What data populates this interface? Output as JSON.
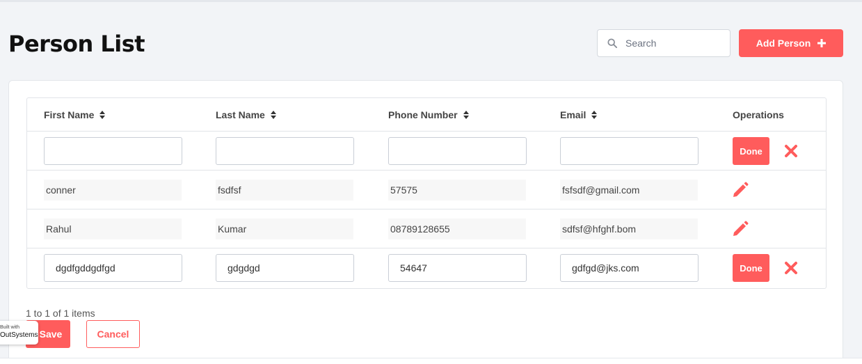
{
  "page": {
    "title": "Person List",
    "search_placeholder": "Search",
    "add_button_label": "Add Person",
    "add_button_icon": "plus-icon",
    "accent_color": "#ff5c5c"
  },
  "table": {
    "columns": [
      {
        "label": "First Name",
        "sortable": true
      },
      {
        "label": "Last Name",
        "sortable": true
      },
      {
        "label": "Phone Number",
        "sortable": true
      },
      {
        "label": "Email",
        "sortable": true
      },
      {
        "label": "Operations",
        "sortable": false
      }
    ],
    "rows": [
      {
        "mode": "edit",
        "first_name": "",
        "last_name": "",
        "phone": "",
        "email": "",
        "done_label": "Done"
      },
      {
        "mode": "view",
        "first_name": "conner",
        "last_name": "fsdfsf",
        "phone": "57575",
        "email": "fsfsdf@gmail.com"
      },
      {
        "mode": "view",
        "first_name": "Rahul",
        "last_name": "Kumar",
        "phone": "08789128655",
        "email": "sdfsf@hfghf.bom"
      },
      {
        "mode": "edit",
        "first_name": "dgdfgddgdfgd",
        "last_name": "gdgdgd",
        "phone": "54647",
        "email": "gdfgd@jks.com",
        "done_label": "Done"
      }
    ]
  },
  "footer": {
    "pager_text": "1 to 1 of 1 items",
    "save_label": "Save",
    "cancel_label": "Cancel"
  },
  "badge": {
    "small": "Built with",
    "big": "OutSystems"
  }
}
